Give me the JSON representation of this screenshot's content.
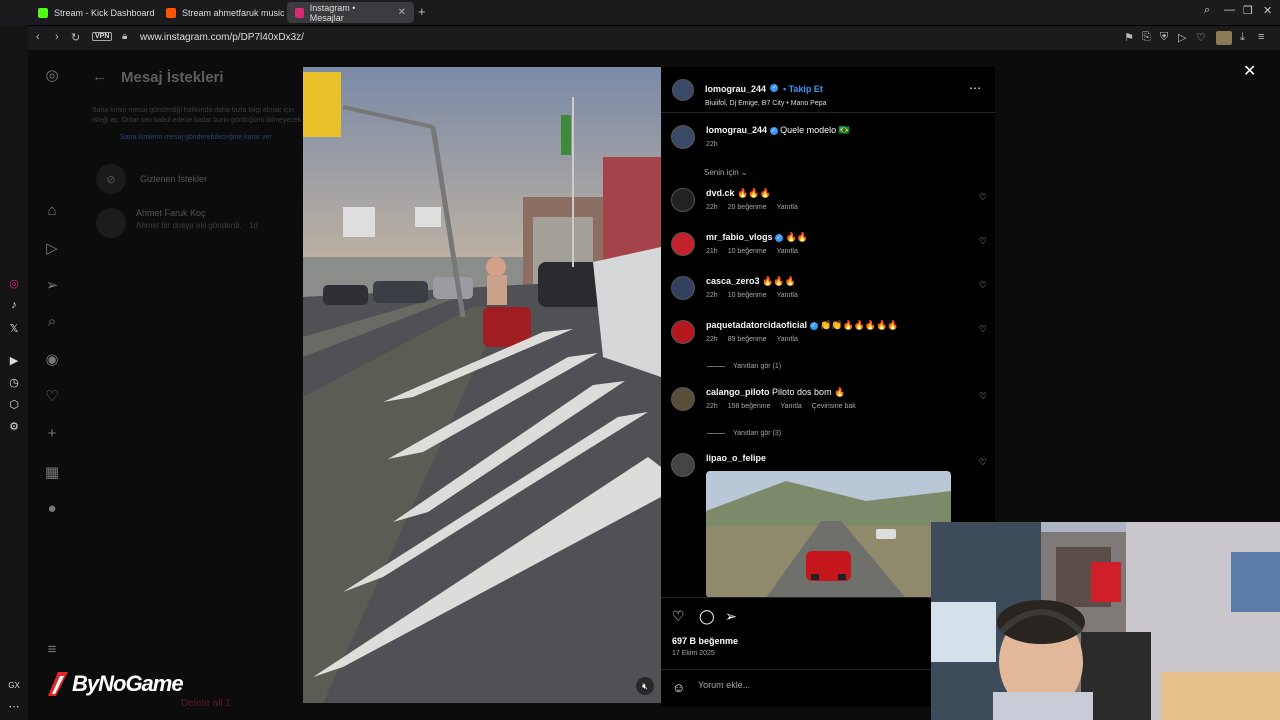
{
  "browser": {
    "tabs": [
      {
        "title": "Stream - Kick Dashboard",
        "color": "#53fc18",
        "active": false
      },
      {
        "title": "Stream ahmetfaruk music",
        "color": "#ff5500",
        "active": false
      },
      {
        "title": "Instagram • Mesajlar",
        "color": "#d62976",
        "active": true
      }
    ],
    "vpn_label": "VPN",
    "url": "www.instagram.com/p/DP7l40xDx3z/"
  },
  "messages_bg": {
    "title": "Mesaj İstekleri",
    "description": "Sana kimin mesaj gönderdiği hakkında daha fazla bilgi almak için isteği aç. Onlar sen kabul edene kadar bunu gördüğünü bilmeyecek.",
    "link": "Sana kimlerin mesaj gönderebileceğine karar ver",
    "hidden_requests": "Gizlenen İstekler",
    "request": {
      "name": "Ahmet Faruk Koç",
      "preview": "Ahmet bir dosya eki gönderdi. · 1d"
    },
    "delete_all": "Delete all 1"
  },
  "post": {
    "author": "lomograu_244",
    "follow": "• Takip Et",
    "audio": "Biuiifol, Dj Emige, B7 City • Mano Pepa",
    "caption_user": "lomograu_244",
    "caption": "Quele modelo 🇧🇷",
    "caption_time": "22h",
    "for_you": "Senin için",
    "likes": "697 B beğenme",
    "date": "17 Ekim 2025",
    "comment_placeholder": "Yorum ekle..."
  },
  "comments": [
    {
      "user": "dvd.ck",
      "verified": false,
      "text": "🔥🔥🔥",
      "time": "22h",
      "likes": "20 beğenme",
      "reply": "Yanıtla"
    },
    {
      "user": "mr_fabio_vlogs",
      "verified": true,
      "text": "🔥🔥",
      "time": "21h",
      "likes": "10 beğenme",
      "reply": "Yanıtla"
    },
    {
      "user": "casca_zero3",
      "verified": false,
      "text": "🔥🔥🔥",
      "time": "22h",
      "likes": "10 beğenme",
      "reply": "Yanıtla"
    },
    {
      "user": "paquetadatorcidaoficial",
      "verified": true,
      "text": "👏👏🔥🔥🔥🔥🔥",
      "time": "22h",
      "likes": "89 beğenme",
      "reply": "Yanıtla",
      "view_replies": "Yanıtları gör (1)"
    },
    {
      "user": "calango_piloto",
      "verified": false,
      "text": "Piloto dos bom 🔥",
      "time": "22h",
      "likes": "158 beğenme",
      "reply": "Yanıtla",
      "translate": "Çevirisine bak",
      "view_replies": "Yanıtları gör (3)"
    },
    {
      "user": "lipao_o_felipe",
      "verified": false,
      "text": "",
      "time": "",
      "likes": "",
      "reply": ""
    }
  ],
  "watermark": "ByNoGame",
  "colors": {
    "accent": "#3897f0",
    "bg": "#000000"
  }
}
